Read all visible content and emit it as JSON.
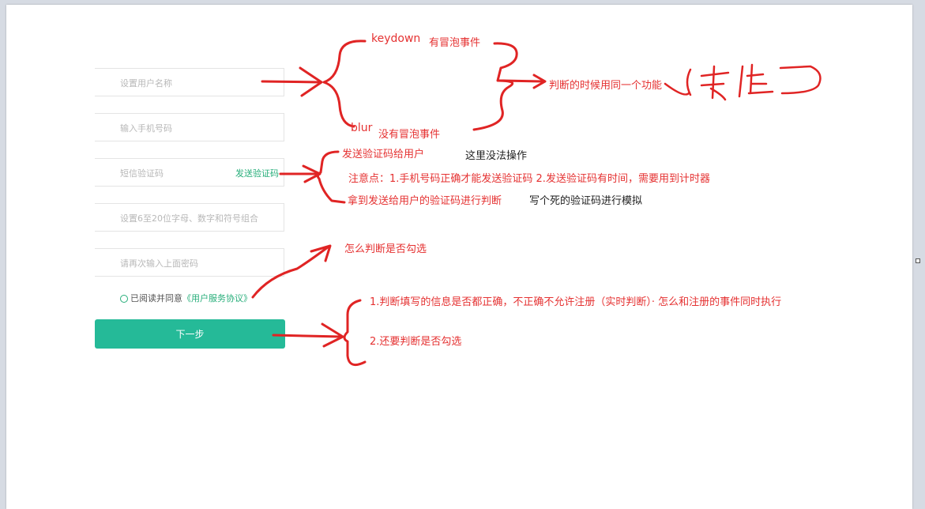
{
  "form": {
    "username_placeholder": "设置用户名称",
    "phone_placeholder": "输入手机号码",
    "sms_placeholder": "短信验证码",
    "sms_button": "发送验证码",
    "password_placeholder": "设置6至20位字母、数字和符号组合",
    "confirm_placeholder": "请再次输入上面密码",
    "agree_text": "已阅读并同意",
    "agree_link": "《用户服务协议》",
    "next_button": "下一步"
  },
  "annotations": {
    "keydown": "keydown",
    "keydown_note": "有冒泡事件",
    "blur": "blur",
    "blur_note": "没有冒泡事件",
    "same_function": "判断的时候用同一个功能",
    "pass_value": "传值",
    "send_code": "发送验证码给用户",
    "no_operation": "这里没法操作",
    "notes": "注意点：1.手机号码正确才能发送验证码 2.发送验证码有时间，需要用到计时器",
    "verify_code": "拿到发送给用户的验证码进行判断",
    "mock_code": "写个死的验证码进行模拟",
    "check_agree": "怎么判断是否勾选",
    "validate_all": "1.判断填写的信息是否都正确，不正确不允许注册（实时判断）· 怎么和注册的事件同时执行",
    "check_agree_again": "2.还要判断是否勾选"
  },
  "colors": {
    "ink_red": "#e02424",
    "accent_green": "#25ba98"
  }
}
